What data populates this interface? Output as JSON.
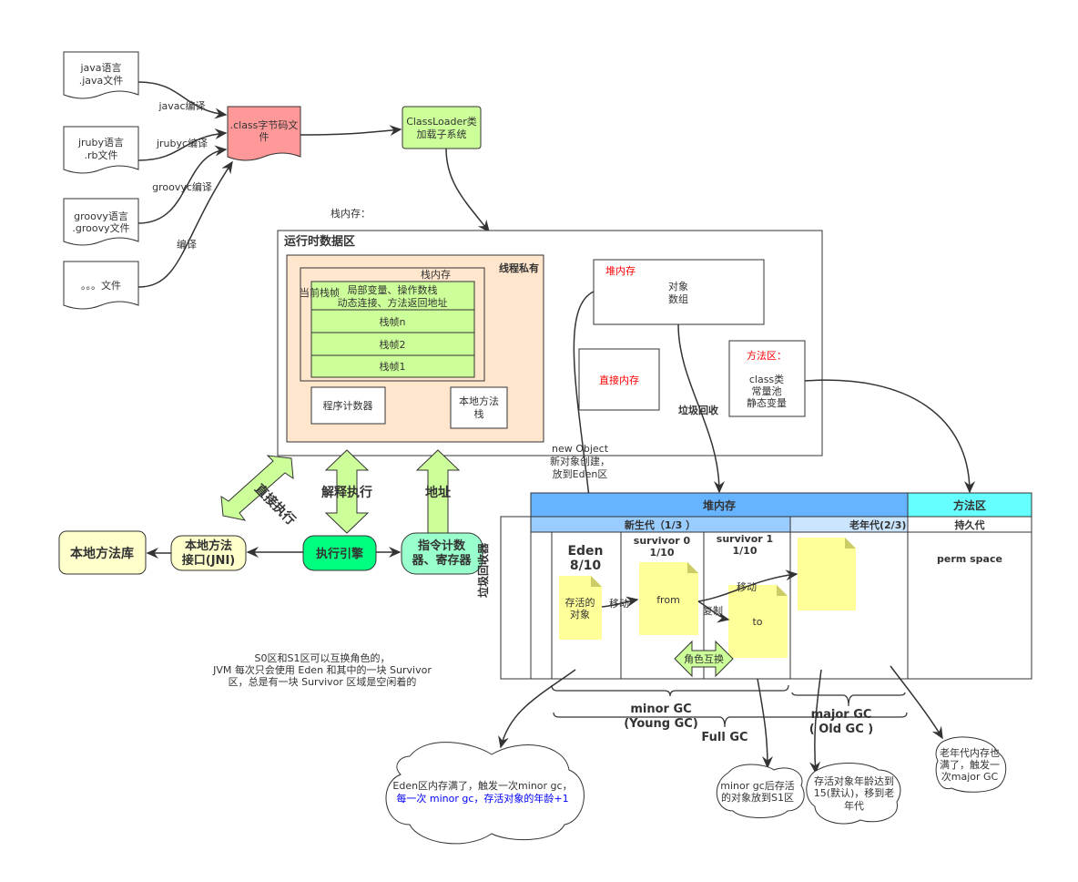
{
  "sources": [
    {
      "l1": "java语言",
      "l2": ".java文件",
      "edge": "javac编译"
    },
    {
      "l1": "jruby语言",
      "l2": ".rb文件",
      "edge": "jrubyc编译"
    },
    {
      "l1": "groovy语言",
      "l2": ".groovy文件",
      "edge": "groovyc编译"
    },
    {
      "l1": "。。。文件",
      "l2": "",
      "edge": "编译"
    }
  ],
  "class_file": {
    "l1": ".class字节码文",
    "l2": "件"
  },
  "classloader": {
    "l1": "ClassLoader类",
    "l2": "加载子系统"
  },
  "stack_memory_note": "栈内存：",
  "runtime": {
    "title": "运行时数据区",
    "thread_private": "线程私有",
    "stack": "栈内存",
    "current_frame": "当前栈帧",
    "frame_top1": "局部变量、操作数栈",
    "frame_top2": "动态连接、方法返回地址",
    "frames": [
      "栈帧n",
      "栈帧2",
      "栈帧1"
    ],
    "pc": "程序计数器",
    "native_stack1": "本地方法",
    "native_stack2": "栈",
    "heap_title": "堆内存",
    "heap1": "对象",
    "heap2": "数组",
    "direct": "直接内存",
    "method_title": "方法区：",
    "method_items": [
      "class类",
      "常量池",
      "静态变量"
    ]
  },
  "gc_label": "垃圾回收",
  "new_object": [
    "new Object",
    "新对象创建，",
    "放到Eden区"
  ],
  "arrows": {
    "direct_exec": "直接执行",
    "interpret": "解释执行",
    "address": "地址"
  },
  "bottom": {
    "native_lib": "本地方法库",
    "jni1": "本地方法",
    "jni2": "接口(JNI)",
    "engine": "执行引擎",
    "pc1": "指令计数",
    "pc2": "器、寄存器"
  },
  "heap_table": {
    "heap": "堆内存",
    "method_area": "方法区",
    "young": "新生代（1/3 ）",
    "old": "老年代(2/3)",
    "perm_gen": "持久代",
    "collector": "垃圾回收器",
    "eden1": "Eden",
    "eden2": "8/10",
    "s0a": "survivor 0",
    "s0b": "1/10",
    "s1a": "survivor 1",
    "s1b": "1/10",
    "perm_space": "perm space",
    "survived1": "存活的",
    "survived2": "对象",
    "move1": "移动",
    "from": "from",
    "to": "to",
    "copy": "复制",
    "move2": "移动",
    "swap": "角色互换"
  },
  "survivor_note": [
    "S0区和S1区可以互换角色的，",
    "JVM 每次只会使用 Eden 和其中的一块 Survivor",
    "区，总是有一块 Survivor 区域是空闲着的"
  ],
  "gc": {
    "minor1": "minor GC",
    "minor2": "(Young GC)",
    "major1": "major GC",
    "major2": "( Old GC )",
    "full": "Full GC"
  },
  "clouds": {
    "eden1": "Eden区内存满了，触发一次minor gc，",
    "eden2": "每一次 minor gc，存活对象的年龄+1",
    "s1a": "minor gc后存活",
    "s1b": "的对象放到S1区",
    "age1": "存活对象年龄达到",
    "age2": "15(默认)，移到老",
    "age3": "年代",
    "old1": "老年代内存也",
    "old2": "满了，触发一",
    "old3": "次major GC"
  },
  "colors": {
    "class_file": "#ff9999",
    "green": "#ccff99",
    "thread": "#ffe6cc",
    "heap_header": "#66b3ff",
    "method_header": "#66ffff",
    "young": "#99ccff",
    "old": "#cce5ff",
    "note": "#ffff99",
    "red_text": "#ff0000",
    "blue_text": "#0000ff"
  }
}
